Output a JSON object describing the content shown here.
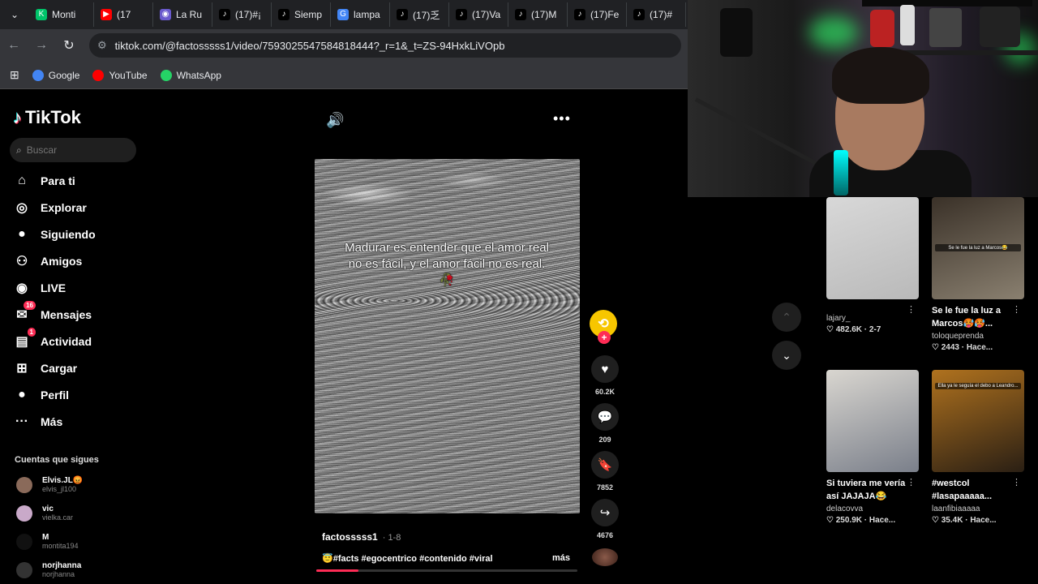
{
  "browser": {
    "tabs": [
      {
        "label": "Monti",
        "color": "#00c46a",
        "glyph": "K"
      },
      {
        "label": "(17",
        "color": "#ff0000",
        "glyph": "▶"
      },
      {
        "label": "La Ru",
        "color": "#6a5acd",
        "glyph": "◉"
      },
      {
        "label": "(17)#¡",
        "color": "#000000",
        "glyph": "♪"
      },
      {
        "label": "Siemp",
        "color": "#000000",
        "glyph": "♪"
      },
      {
        "label": "lampa",
        "color": "#4285f4",
        "glyph": "G"
      },
      {
        "label": "(17)乏",
        "color": "#000000",
        "glyph": "♪"
      },
      {
        "label": "(17)Va",
        "color": "#000000",
        "glyph": "♪"
      },
      {
        "label": "(17)M",
        "color": "#000000",
        "glyph": "♪"
      },
      {
        "label": "(17)Fe",
        "color": "#000000",
        "glyph": "♪"
      },
      {
        "label": "(17)#",
        "color": "#000000",
        "glyph": "♪"
      }
    ],
    "url": "tiktok.com/@factosssss1/video/7593025547584818444?_r=1&_t=ZS-94HxkLiVOpb",
    "bookmarks": [
      {
        "label": "Google",
        "color": "#4285f4"
      },
      {
        "label": "YouTube",
        "color": "#ff0000"
      },
      {
        "label": "WhatsApp",
        "color": "#25d366"
      }
    ]
  },
  "sidebar": {
    "logo": "TikTok",
    "search_placeholder": "Buscar",
    "nav": [
      {
        "label": "Para ti",
        "icon": "home-icon",
        "glyph": "⌂",
        "badge": ""
      },
      {
        "label": "Explorar",
        "icon": "compass-icon",
        "glyph": "◎",
        "badge": ""
      },
      {
        "label": "Siguiendo",
        "icon": "following-avatar-icon",
        "glyph": "●",
        "badge": ""
      },
      {
        "label": "Amigos",
        "icon": "friends-icon",
        "glyph": "⚇",
        "badge": ""
      },
      {
        "label": "LIVE",
        "icon": "live-icon",
        "glyph": "◉",
        "badge": ""
      },
      {
        "label": "Mensajes",
        "icon": "messages-icon",
        "glyph": "✉",
        "badge": "16"
      },
      {
        "label": "Actividad",
        "icon": "activity-icon",
        "glyph": "▤",
        "badge": "1"
      },
      {
        "label": "Cargar",
        "icon": "upload-icon",
        "glyph": "⊞",
        "badge": ""
      },
      {
        "label": "Perfil",
        "icon": "profile-icon",
        "glyph": "●",
        "badge": ""
      },
      {
        "label": "Más",
        "icon": "more-dots-icon",
        "glyph": "···",
        "badge": ""
      }
    ],
    "following_title": "Cuentas que sigues",
    "following": [
      {
        "name": "Elvis.JL😡",
        "user": "elvis_jl100"
      },
      {
        "name": "vic",
        "user": "vielka.car"
      },
      {
        "name": "M",
        "user": "montita194"
      },
      {
        "name": "norjhanna",
        "user": "norjhanna"
      }
    ]
  },
  "video": {
    "caption": "Madurar es entender que el amor real no es fácil, y el amor fácil no es real. 🥀",
    "author": "factosssss1",
    "date": "· 1-8",
    "description": "😇#facts #egocentrico #contenido #viral",
    "more_label": "más",
    "progress": 0.16
  },
  "actions": [
    {
      "name": "like",
      "glyph": "♥",
      "count": "60.2K"
    },
    {
      "name": "comment",
      "glyph": "💬",
      "count": "209"
    },
    {
      "name": "bookmark",
      "glyph": "🔖",
      "count": "7852"
    },
    {
      "name": "share",
      "glyph": "↪",
      "count": "4676"
    }
  ],
  "recommended": [
    {
      "title": "",
      "author": "lajary_",
      "stats": "♡ 482.6K · 2-7",
      "overlay": "",
      "colors": [
        "#d8d8d8",
        "#b9b9b9"
      ]
    },
    {
      "title": "Se le fue la luz a Marcos🥵🥵...",
      "author": "toloqueprenda",
      "stats": "♡ 2443 · Hace...",
      "overlay": "Se le fue la luz a Marcos😂",
      "colors": [
        "#3a3128",
        "#8a8070"
      ]
    },
    {
      "title": "Si tuviera me vería así JAJAJA😂",
      "author": "delacovva",
      "stats": "♡ 250.9K · Hace...",
      "overlay": "",
      "colors": [
        "#d9d6d0",
        "#7a7f8a"
      ]
    },
    {
      "title": "#westcol #lasapaaaaa...",
      "author": "laanfibiaaaaa",
      "stats": "♡ 35.4K · Hace...",
      "overlay": "Ella ya le seguía el debo a Leandro...",
      "colors": [
        "#b0721e",
        "#2a1f14"
      ]
    }
  ]
}
